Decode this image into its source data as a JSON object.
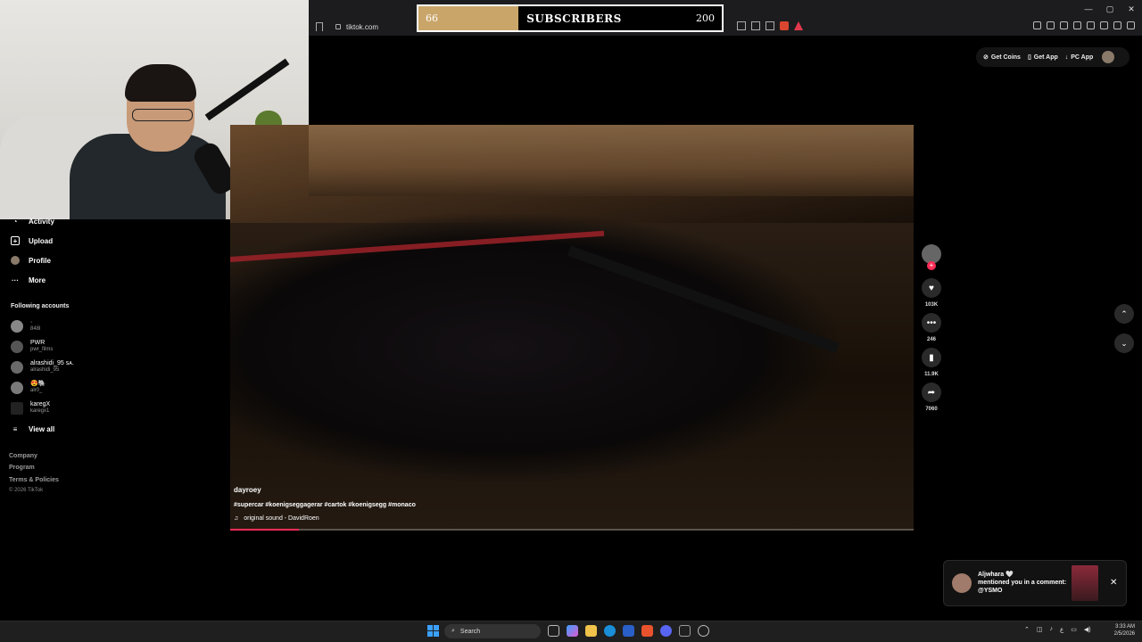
{
  "browser": {
    "url": "tiktok.com",
    "window_controls": [
      "—",
      "▢",
      "✕"
    ]
  },
  "subscriber_goal": {
    "current": "66",
    "label": "SUBSCRIBERS",
    "goal": "200",
    "progress_fraction": 0.33,
    "fill_color": "#c9a56a"
  },
  "sidebar": {
    "items": [
      {
        "label": "Activity",
        "icon": "activity-icon"
      },
      {
        "label": "Upload",
        "icon": "upload-icon"
      },
      {
        "label": "Profile",
        "icon": "profile-icon"
      },
      {
        "label": "More",
        "icon": "more-icon"
      }
    ],
    "following_title": "Following accounts",
    "accounts": [
      {
        "name": "·",
        "handle": "848l"
      },
      {
        "name": "PWR",
        "handle": "pwr_films"
      },
      {
        "name": "alrashidi_95 ꜱᴀ.",
        "handle": "alrashidi_95"
      },
      {
        "name": "😍🐘",
        "handle": "alr0_"
      },
      {
        "name": "karegX",
        "handle": "karegx1"
      }
    ],
    "view_all": "View all",
    "footer": [
      "Company",
      "Program",
      "Terms & Policies"
    ],
    "copyright": "© 2026 TikTok"
  },
  "top_actions": {
    "get_coins": "Get Coins",
    "get_app": "Get App",
    "pc_app": "PC App"
  },
  "video": {
    "author": "dayroey",
    "description": "#supercar #koenigseggagerar #cartok #koenigsegg #monaco",
    "sound": "original sound - DavidRoen",
    "progress_fraction": 0.1,
    "accent_color": "#fe2c55"
  },
  "rail": {
    "likes": "103K",
    "comments": "246",
    "saves": "11.9K",
    "shares": "7060"
  },
  "notification": {
    "user": "Aljwhara 🤍",
    "text": "mentioned you in a comment: @YSMO"
  },
  "taskbar": {
    "search_placeholder": "Search",
    "time": "3:33 AM",
    "date": "2/5/2026"
  }
}
